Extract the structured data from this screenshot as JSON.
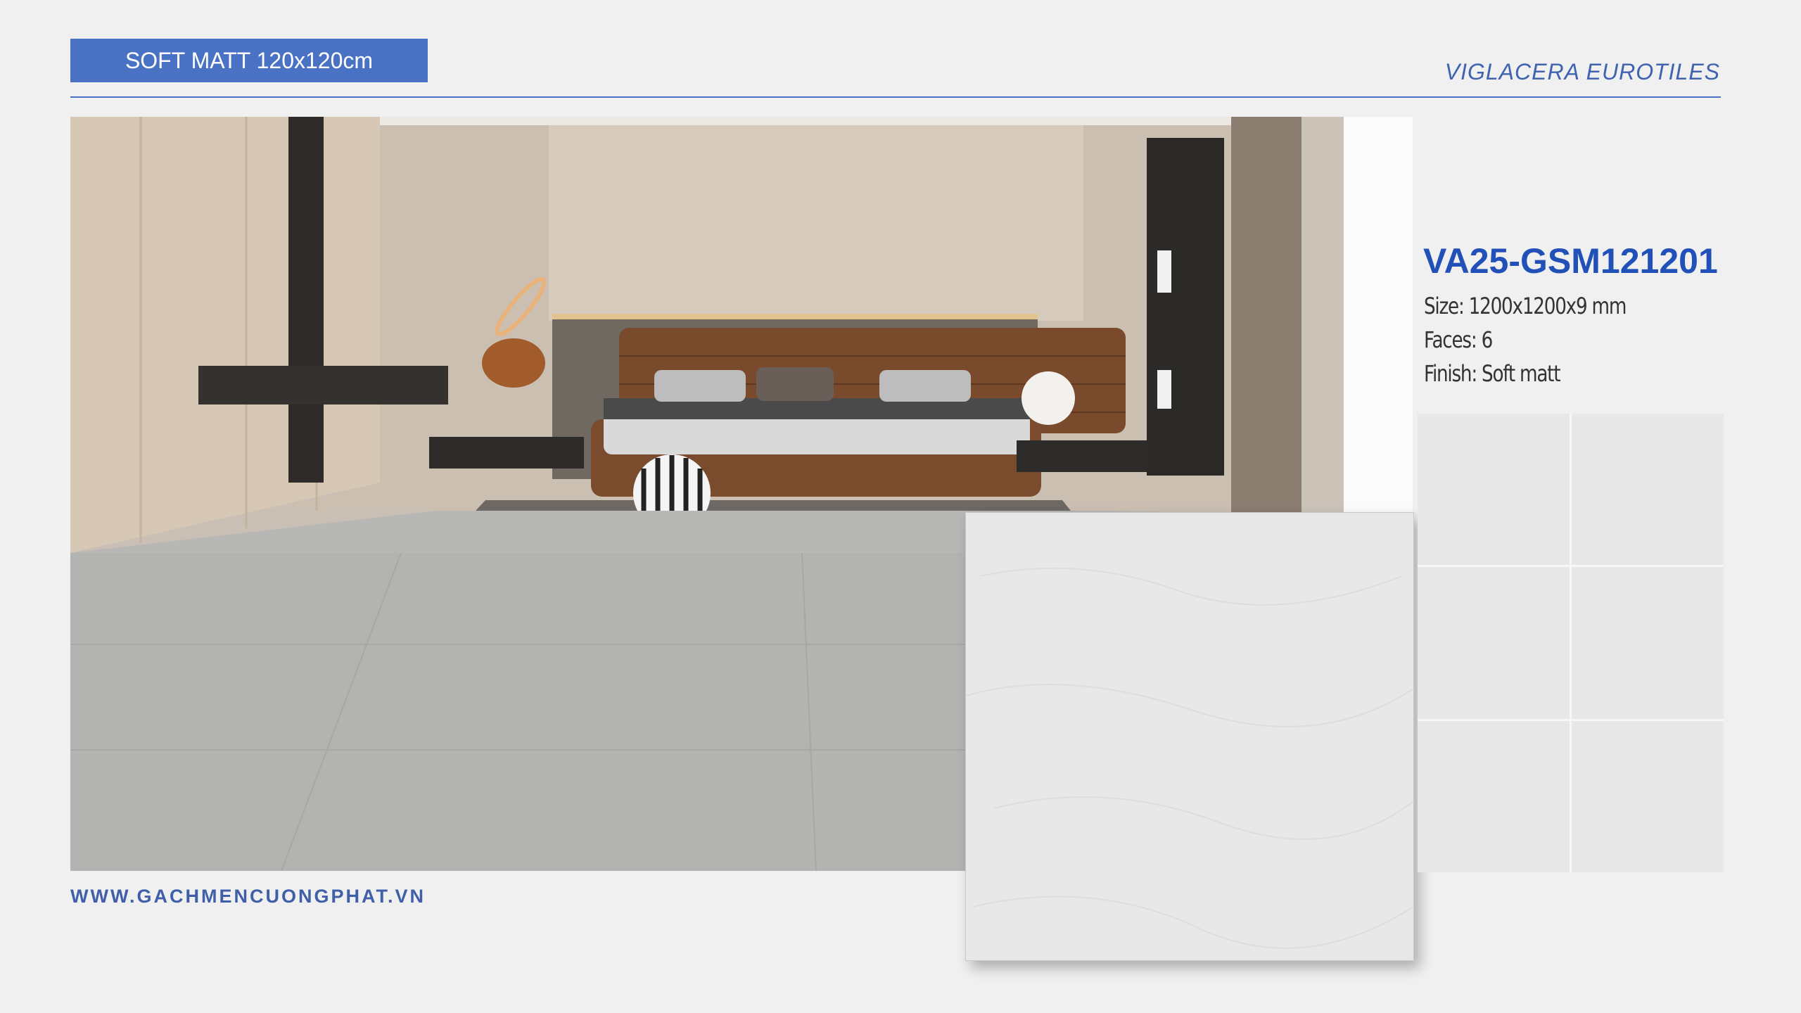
{
  "header": {
    "collection_title": "SOFT MATT 120x120cm",
    "brand": "VIGLACERA EUROTILES"
  },
  "product": {
    "code": "VA25-GSM121201",
    "size": "Size: 1200x1200x9 mm",
    "faces": "Faces: 6",
    "finish": "Finish: Soft matt"
  },
  "footer": {
    "website": "WWW.GACHMENCUONGPHAT.VN"
  },
  "images": {
    "room": "bedroom-render-photo",
    "tile": "tile-sample-image",
    "grid": "tile-layout-grid"
  }
}
